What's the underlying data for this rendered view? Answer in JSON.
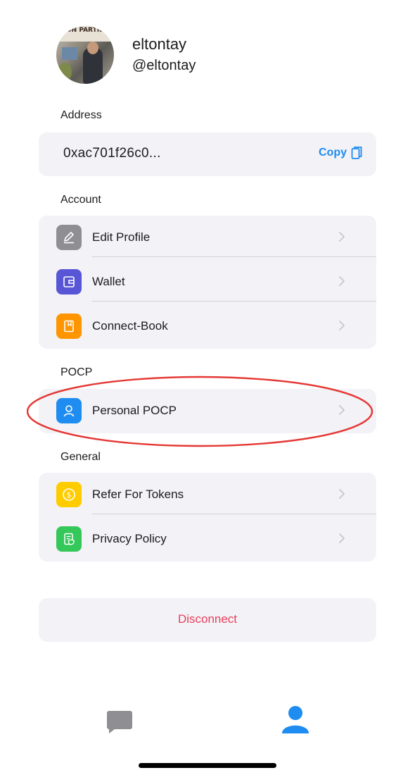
{
  "profile": {
    "display_name": "eltontay",
    "handle": "@eltontay",
    "avatar_banner_text": "ON PARTN"
  },
  "address": {
    "section_label": "Address",
    "value": "0xac701f26c0...",
    "copy_label": "Copy"
  },
  "account": {
    "section_label": "Account",
    "items": [
      {
        "label": "Edit Profile",
        "icon": "pencil-icon",
        "color": "#8e8e93"
      },
      {
        "label": "Wallet",
        "icon": "wallet-icon",
        "color": "#5856d6"
      },
      {
        "label": "Connect-Book",
        "icon": "book-icon",
        "color": "#ff9500"
      }
    ]
  },
  "pocp": {
    "section_label": "POCP",
    "items": [
      {
        "label": "Personal POCP",
        "icon": "person-icon",
        "color": "#1e8cf0"
      }
    ]
  },
  "general": {
    "section_label": "General",
    "items": [
      {
        "label": "Refer For Tokens",
        "icon": "dollar-coin-icon",
        "color": "#ffcc00"
      },
      {
        "label": "Privacy Policy",
        "icon": "policy-document-icon",
        "color": "#34c759"
      }
    ]
  },
  "disconnect": {
    "label": "Disconnect",
    "color": "#e8405c"
  },
  "tab_bar": {
    "tabs": [
      {
        "icon": "chat-bubble-icon",
        "active": false
      },
      {
        "icon": "profile-icon",
        "active": true
      }
    ]
  },
  "colors": {
    "accent": "#1e8cf0",
    "card_background": "#f2f2f7",
    "annotation": "#e53935"
  }
}
